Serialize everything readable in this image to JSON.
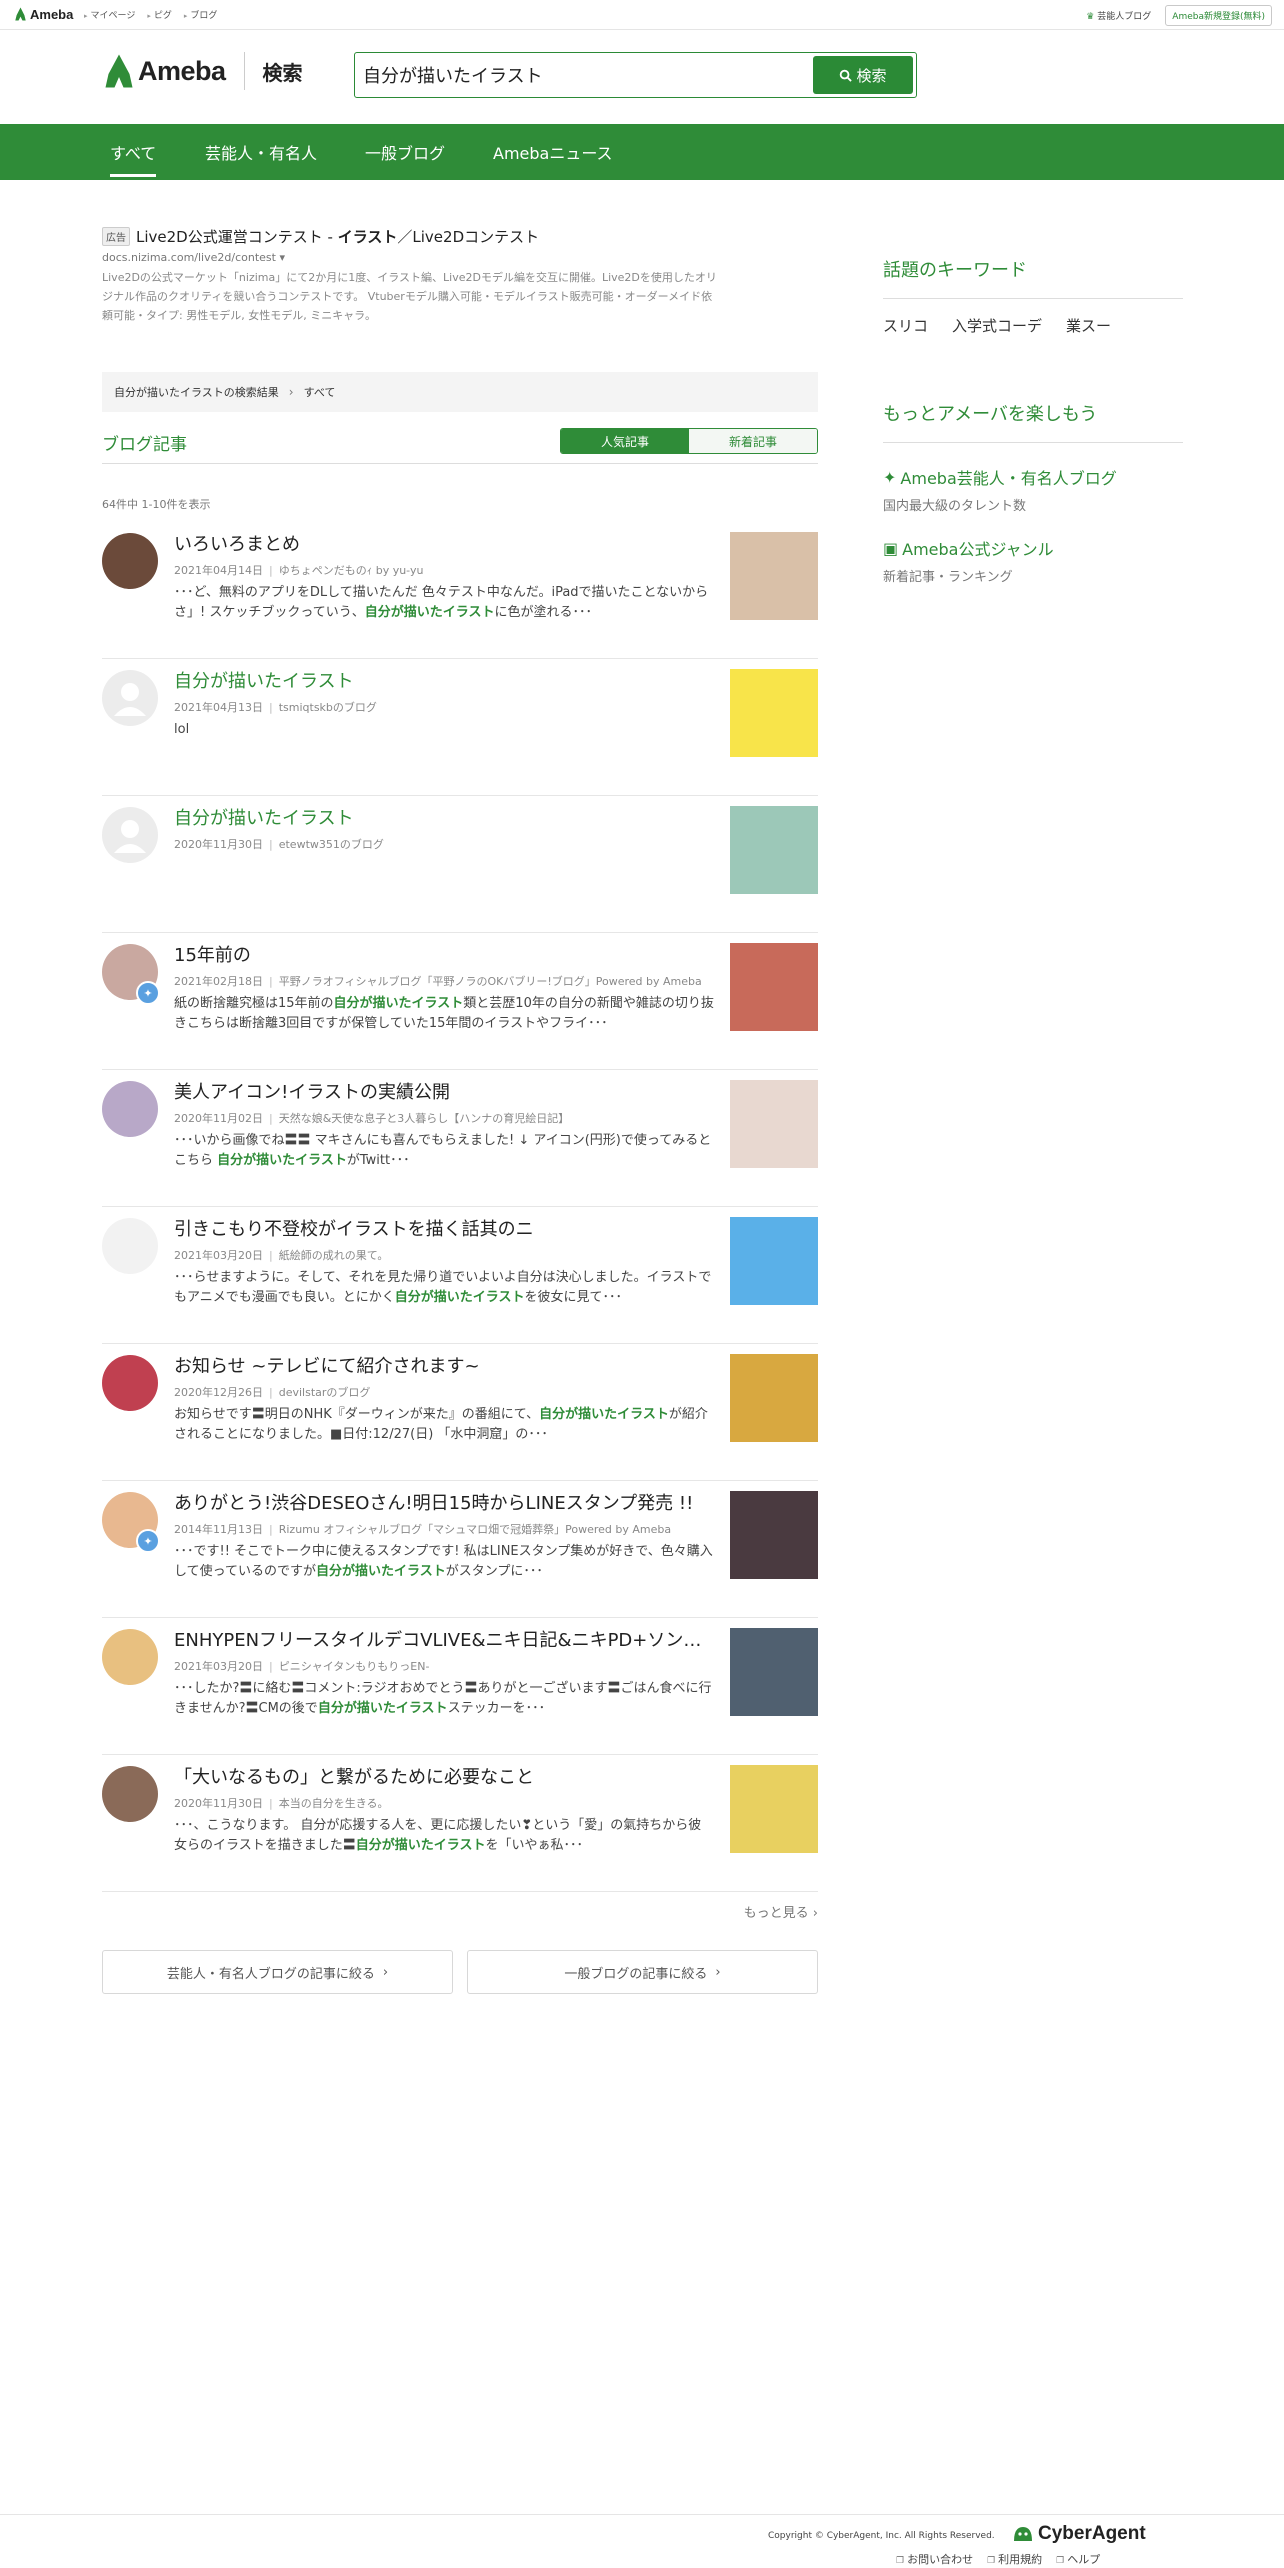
{
  "topbar": {
    "logo": "Ameba",
    "links": [
      "マイページ",
      "ピグ",
      "ブログ"
    ],
    "celeb_link": "芸能人ブログ",
    "register": "Ameba新規登録(無料)"
  },
  "header": {
    "brand": "Ameba",
    "search_label": "検索",
    "query": "自分が描いたイラスト",
    "search_button": "検索"
  },
  "nav": {
    "tabs": [
      "すべて",
      "芸能人・有名人",
      "一般ブログ",
      "Amebaニュース"
    ],
    "active": 0
  },
  "ad": {
    "badge": "広告",
    "title_pre": "Live2D公式運営コンテスト - ",
    "title_bold": "イラスト",
    "title_post": "／Live2Dコンテスト",
    "url": "docs.nizima.com/live2d/contest",
    "desc": "Live2Dの公式マーケット「nizima」にて2か月に1度、イラスト編、Live2Dモデル編を交互に開催。Live2Dを使用したオリジナル作品のクオリティを競い合うコンテストです。 Vtuberモデル購入可能・モデルイラスト販売可能・オーダーメイド依頼可能・タイプ: 男性モデル, 女性モデル, ミニキャラ。"
  },
  "breadcrumb": {
    "result": "自分が描いたイラストの検索結果",
    "current": "すべて"
  },
  "section": {
    "title": "ブログ記事",
    "toggle_popular": "人気記事",
    "toggle_new": "新着記事",
    "count": "64件中 1-10件を表示"
  },
  "results": [
    {
      "title": "いろいろまとめ",
      "green": false,
      "date": "2021年04月14日",
      "blog": "ゆちょペンだものｨ by yu-yu",
      "pre": "･･･ど、無料のアプリをDLして描いたんだ 色々テスト中なんだ。iPadで描いたことないからさ」! スケッチブックっていう、",
      "hl": "自分が描いたイラスト",
      "post": "に色が塗れる･･･",
      "avatar": "#6b4a3a",
      "thumb": "#d9c0a8",
      "official": false
    },
    {
      "title": "自分が描いたイラスト",
      "green": true,
      "date": "2021年04月13日",
      "blog": "tsmiqtskbのブログ",
      "pre": "lol",
      "hl": "",
      "post": "",
      "avatar": "",
      "thumb": "#f8e44a",
      "official": false
    },
    {
      "title": "自分が描いたイラスト",
      "green": true,
      "date": "2020年11月30日",
      "blog": "etewtw351のブログ",
      "pre": "",
      "hl": "",
      "post": "",
      "avatar": "",
      "thumb": "#9cc8b8",
      "official": false
    },
    {
      "title": "15年前の",
      "green": false,
      "date": "2021年02月18日",
      "blog": "平野ノラオフィシャルブログ「平野ノラのOKバブリー!ブログ」Powered by Ameba",
      "pre": "紙の断捨離究極は15年前の",
      "hl": "自分が描いたイラスト",
      "post": "類と芸歴10年の自分の新聞や雑誌の切り抜きこちらは断捨離3回目ですが保管していた15年間のイラストやフライ･･･",
      "avatar": "#c9a8a0",
      "thumb": "#c86a5a",
      "official": true
    },
    {
      "title": "美人アイコン!イラストの実績公開",
      "green": false,
      "date": "2020年11月02日",
      "blog": "天然な娘&天使な息子と3人暮らし【ハンナの育児絵日記】",
      "pre": "･･･いから画像でね〓〓 マキさんにも喜んでもらえました! ↓ アイコン(円形)で使ってみるとこちら ",
      "hl": "自分が描いたイラスト",
      "post": "がTwitt･･･",
      "avatar": "#b8a8c8",
      "thumb": "#e8d8d0",
      "official": false
    },
    {
      "title": "引きこもり不登校がイラストを描く話其のニ",
      "green": false,
      "date": "2021年03月20日",
      "blog": "紙絵師の成れの果て。",
      "pre": "･･･らせますように。そして、それを見た帰り道でいよいよ自分は決心しました。イラストでもアニメでも漫画でも良い。とにかく",
      "hl": "自分が描いたイラスト",
      "post": "を彼女に見て･･･",
      "avatar": "#f2f2f2",
      "thumb": "#5ab0e8",
      "official": false
    },
    {
      "title": "お知らせ ~テレビにて紹介されます~",
      "green": false,
      "date": "2020年12月26日",
      "blog": "devilstarのブログ",
      "pre": "お知らせです〓明日のNHK『ダーウィンが来た』の番組にて、",
      "hl": "自分が描いたイラスト",
      "post": "が紹介されることになりました。■日付:12/27(日) 「水中洞窟」の･･･",
      "avatar": "#c04050",
      "thumb": "#d8a840",
      "official": false
    },
    {
      "title": "ありがとう!渋谷DESEOさん!明日15時からLINEスタンプ発売 !!",
      "green": false,
      "date": "2014年11月13日",
      "blog": "Rizumu オフィシャルブログ「マシュマロ畑で冠婚葬祭」Powered by Ameba",
      "pre": "･･･です!! そこでトーク中に使えるスタンプです! 私はLINEスタンプ集めが好きで、色々購入して使っているのですが",
      "hl": "自分が描いたイラスト",
      "post": "がスタンプに･･･",
      "avatar": "#e8b890",
      "thumb": "#4a3a40",
      "official": true
    },
    {
      "title": "ENHYPENフリースタイルデコVLIVE&ニキ日記&ニキPD+ソンギ…",
      "green": false,
      "date": "2021年03月20日",
      "blog": "ピニシャイタンもりもりっEN-",
      "pre": "･･･したか?〓に絡む〓コメント:ラジオおめでとう〓ありがと一ございます〓ごはん食べに行きませんか?〓CMの後で",
      "hl": "自分が描いたイラスト",
      "post": "ステッカーを･･･",
      "avatar": "#e8c080",
      "thumb": "#506070",
      "official": false
    },
    {
      "title": "「大いなるもの」と繋がるために必要なこと",
      "green": false,
      "date": "2020年11月30日",
      "blog": "本当の自分を生きる。",
      "pre": "･･･、こうなります。 自分が応援する人を、更に応援したい❣という「愛」の氣持ちから彼女らのイラストを描きました〓",
      "hl": "自分が描いたイラスト",
      "post": "を「いやぁ私･･･",
      "avatar": "#8a6a58",
      "thumb": "#e8d060",
      "official": false
    }
  ],
  "more": "もっと見る",
  "filters": [
    "芸能人・有名人ブログの記事に絞る",
    "一般ブログの記事に絞る"
  ],
  "sidebar": {
    "keywords_title": "話題のキーワード",
    "keywords": [
      "スリコ",
      "入学式コーデ",
      "業スー"
    ],
    "enjoy_title": "もっとアメーバを楽しもう",
    "links": [
      {
        "title": "Ameba芸能人・有名人ブログ",
        "sub": "国内最大級のタレント数"
      },
      {
        "title": "Ameba公式ジャンル",
        "sub": "新着記事・ランキング"
      }
    ]
  },
  "footer": {
    "copyright": "Copyright © CyberAgent, Inc. All Rights Reserved.",
    "company": "CyberAgent",
    "links": [
      "お問い合わせ",
      "利用規約",
      "ヘルプ"
    ]
  }
}
